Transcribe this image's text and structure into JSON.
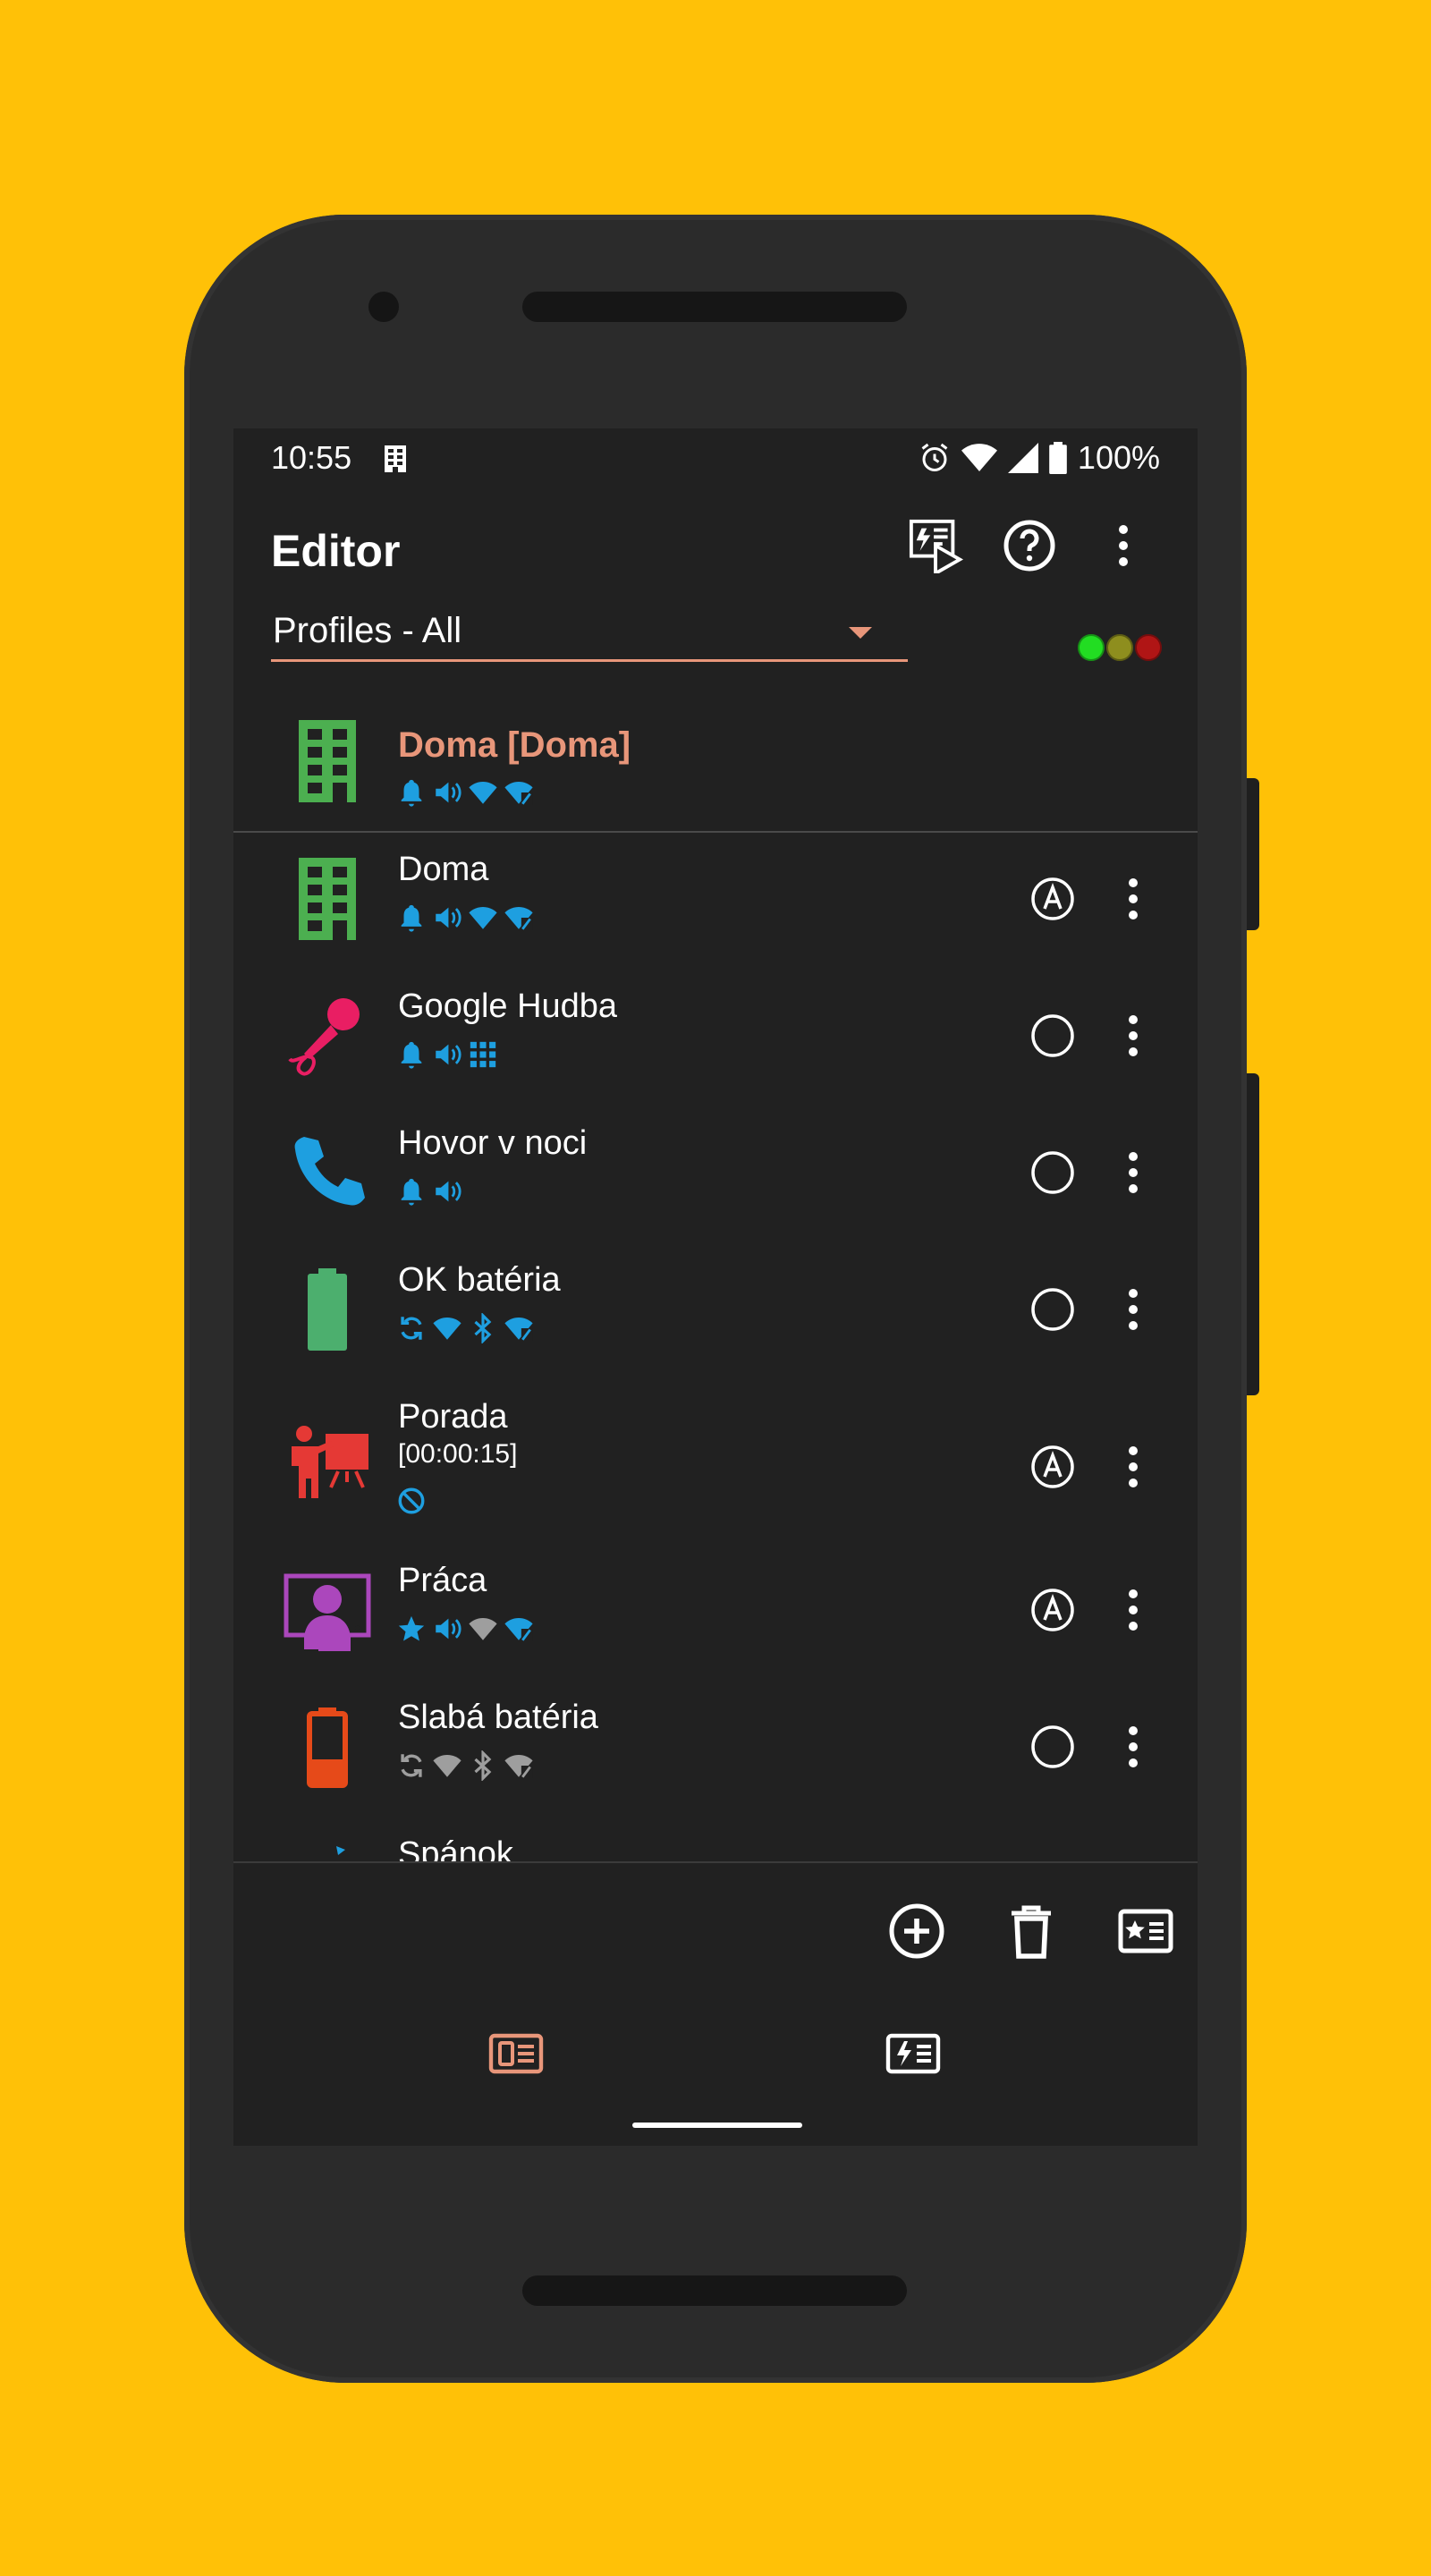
{
  "status_bar": {
    "time": "10:55",
    "battery": "100%"
  },
  "toolbar": {
    "title": "Editor"
  },
  "filter": {
    "label": "Profiles - All"
  },
  "indicator_colors": [
    "#22DD22",
    "#8E8E1E",
    "#B01515"
  ],
  "active_profile": {
    "name": "Doma [Doma]",
    "icon": "building-icon",
    "color": "#E8967A"
  },
  "profiles": [
    {
      "name": "Doma",
      "sub": "",
      "icon": "building-icon",
      "radio": "A"
    },
    {
      "name": "Google Hudba",
      "sub": "",
      "icon": "microphone-icon",
      "radio": "empty"
    },
    {
      "name": "Hovor v noci",
      "sub": "",
      "icon": "phone-icon",
      "radio": "empty"
    },
    {
      "name": "OK batéria",
      "sub": "",
      "icon": "battery-full-icon",
      "radio": "empty"
    },
    {
      "name": "Porada",
      "sub": "[00:00:15]",
      "icon": "presentation-icon",
      "radio": "A"
    },
    {
      "name": "Práca",
      "sub": "",
      "icon": "monitor-person-icon",
      "radio": "A"
    },
    {
      "name": "Slabá batéria",
      "sub": "",
      "icon": "battery-low-icon",
      "radio": "empty"
    },
    {
      "name": "Spánok",
      "sub": "",
      "icon": "sleep-icon",
      "radio": "empty"
    }
  ],
  "colors": {
    "accent": "#E8967A",
    "icon_blue": "#1E9FE0",
    "bg": "#212121",
    "device_bg": "#FFC107"
  }
}
